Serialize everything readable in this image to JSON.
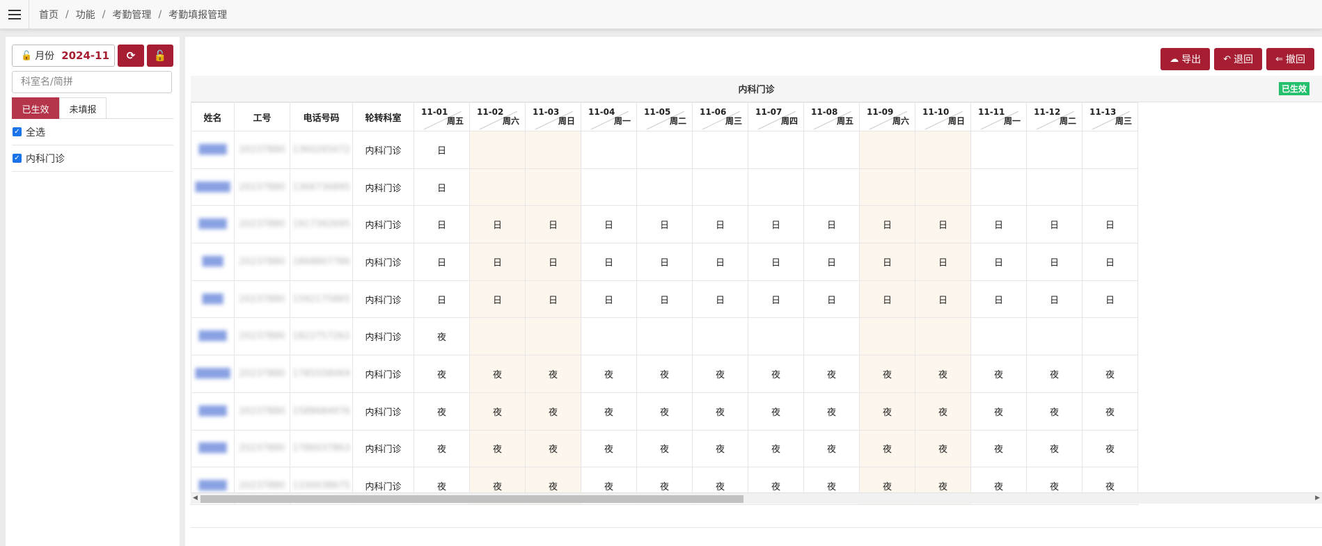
{
  "breadcrumb": [
    "首页",
    "功能",
    "考勤管理",
    "考勤填报管理"
  ],
  "left": {
    "month_label": "月份",
    "month_value": "2024-11",
    "search_placeholder": "科室名/简拼",
    "tabs": [
      {
        "label": "已生效",
        "active": true
      },
      {
        "label": "未填报",
        "active": false
      }
    ],
    "checks": [
      {
        "label": "全选",
        "checked": true
      },
      {
        "label": "内科门诊",
        "checked": true
      }
    ]
  },
  "actions": [
    {
      "label": "导出",
      "icon": "cloud-download-icon"
    },
    {
      "label": "退回",
      "icon": "reply-icon"
    },
    {
      "label": "撤回",
      "icon": "reply-all-icon"
    }
  ],
  "table": {
    "department": "内科门诊",
    "status_badge": "已生效",
    "headers": {
      "name": "姓名",
      "id": "工号",
      "phone": "电话号码",
      "dept": "轮转科室"
    },
    "dates": [
      {
        "date": "11-01",
        "weekday": "周五",
        "weekend": false
      },
      {
        "date": "11-02",
        "weekday": "周六",
        "weekend": true
      },
      {
        "date": "11-03",
        "weekday": "周日",
        "weekend": true
      },
      {
        "date": "11-04",
        "weekday": "周一",
        "weekend": false
      },
      {
        "date": "11-05",
        "weekday": "周二",
        "weekend": false
      },
      {
        "date": "11-06",
        "weekday": "周三",
        "weekend": false
      },
      {
        "date": "11-07",
        "weekday": "周四",
        "weekend": false
      },
      {
        "date": "11-08",
        "weekday": "周五",
        "weekend": false
      },
      {
        "date": "11-09",
        "weekday": "周六",
        "weekend": true
      },
      {
        "date": "11-10",
        "weekday": "周日",
        "weekend": true
      },
      {
        "date": "11-11",
        "weekday": "周一",
        "weekend": false
      },
      {
        "date": "11-12",
        "weekday": "周二",
        "weekend": false
      },
      {
        "date": "11-13",
        "weekday": "周三",
        "weekend": false
      }
    ],
    "rows": [
      {
        "name": "████",
        "id": "20237880",
        "phone": "1360265072",
        "dept": "内科门诊",
        "cells": [
          "日",
          "",
          "",
          "",
          "",
          "",
          "",
          "",
          "",
          "",
          "",
          "",
          ""
        ]
      },
      {
        "name": "█████",
        "id": "20237880",
        "phone": "1366736895",
        "dept": "内科门诊",
        "cells": [
          "日",
          "",
          "",
          "",
          "",
          "",
          "",
          "",
          "",
          "",
          "",
          "",
          ""
        ]
      },
      {
        "name": "████",
        "id": "20237880",
        "phone": "1917392695",
        "dept": "内科门诊",
        "cells": [
          "日",
          "日",
          "日",
          "日",
          "日",
          "日",
          "日",
          "日",
          "日",
          "日",
          "日",
          "日",
          "日"
        ]
      },
      {
        "name": "███",
        "id": "20237880",
        "phone": "1868807786",
        "dept": "内科门诊",
        "cells": [
          "日",
          "日",
          "日",
          "日",
          "日",
          "日",
          "日",
          "日",
          "日",
          "日",
          "日",
          "日",
          "日"
        ]
      },
      {
        "name": "███",
        "id": "20237880",
        "phone": "1592175865",
        "dept": "内科门诊",
        "cells": [
          "日",
          "日",
          "日",
          "日",
          "日",
          "日",
          "日",
          "日",
          "日",
          "日",
          "日",
          "日",
          "日"
        ]
      },
      {
        "name": "████",
        "id": "20237880",
        "phone": "1822757262",
        "dept": "内科门诊",
        "cells": [
          "夜",
          "",
          "",
          "",
          "",
          "",
          "",
          "",
          "",
          "",
          "",
          "",
          ""
        ]
      },
      {
        "name": "█████",
        "id": "20237880",
        "phone": "1785558069",
        "dept": "内科门诊",
        "cells": [
          "夜",
          "夜",
          "夜",
          "夜",
          "夜",
          "夜",
          "夜",
          "夜",
          "夜",
          "夜",
          "夜",
          "夜",
          "夜"
        ]
      },
      {
        "name": "████",
        "id": "20237880",
        "phone": "1588684976",
        "dept": "内科门诊",
        "cells": [
          "夜",
          "夜",
          "夜",
          "夜",
          "夜",
          "夜",
          "夜",
          "夜",
          "夜",
          "夜",
          "夜",
          "夜",
          "夜"
        ]
      },
      {
        "name": "████",
        "id": "20237880",
        "phone": "1786037863",
        "dept": "内科门诊",
        "cells": [
          "夜",
          "夜",
          "夜",
          "夜",
          "夜",
          "夜",
          "夜",
          "夜",
          "夜",
          "夜",
          "夜",
          "夜",
          "夜"
        ]
      },
      {
        "name": "████",
        "id": "20237880",
        "phone": "1330038675",
        "dept": "内科门诊",
        "cells": [
          "夜",
          "夜",
          "夜",
          "夜",
          "夜",
          "夜",
          "夜",
          "夜",
          "夜",
          "夜",
          "夜",
          "夜",
          "夜"
        ]
      }
    ]
  }
}
